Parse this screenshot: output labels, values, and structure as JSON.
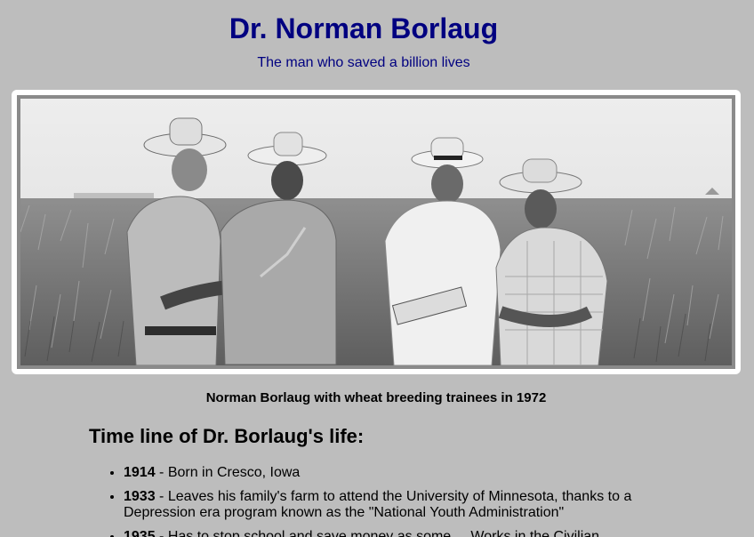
{
  "header": {
    "title": "Dr. Norman Borlaug",
    "subtitle": "The man who saved a billion lives"
  },
  "photo": {
    "caption": "Norman Borlaug with wheat breeding trainees in 1972"
  },
  "timeline": {
    "heading": "Time line of Dr. Borlaug's life:",
    "items": [
      {
        "year": "1914",
        "text": " - Born in Cresco, Iowa"
      },
      {
        "year": "1933",
        "text": " - Leaves his family's farm to attend the University of Minnesota, thanks to a Depression era program known as the \"National Youth Administration\""
      },
      {
        "year": "1935",
        "text": " - Has to stop school and save money as some ... Works in the Civilian"
      }
    ]
  },
  "colors": {
    "background": "#bdbdbd",
    "title": "#000080",
    "frame": "#ffffff"
  }
}
